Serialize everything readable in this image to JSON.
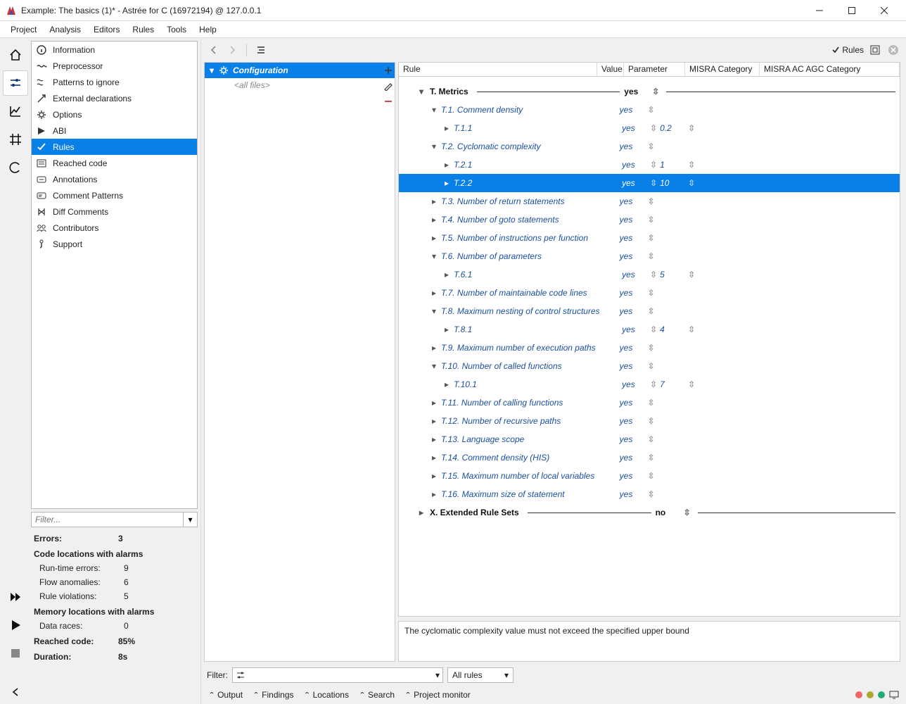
{
  "window": {
    "title": "Example: The basics (1)* - Astrée for C (16972194) @ 127.0.0.1"
  },
  "menubar": [
    "Project",
    "Analysis",
    "Editors",
    "Rules",
    "Tools",
    "Help"
  ],
  "nav": {
    "items": [
      "Information",
      "Preprocessor",
      "Patterns to ignore",
      "External declarations",
      "Options",
      "ABI",
      "Rules",
      "Reached code",
      "Annotations",
      "Comment Patterns",
      "Diff Comments",
      "Contributors",
      "Support"
    ],
    "selected": 6
  },
  "filter_placeholder": "Filter...",
  "stats": {
    "errors_label": "Errors:",
    "errors": "3",
    "cla_header": "Code locations with alarms",
    "rte_label": "Run-time errors:",
    "rte": "9",
    "flow_label": "Flow anomalies:",
    "flow": "6",
    "rulev_label": "Rule violations:",
    "rulev": "5",
    "mem_header": "Memory locations with alarms",
    "dr_label": "Data races:",
    "dr": "0",
    "reached_label": "Reached code:",
    "reached": "85%",
    "dur_label": "Duration:",
    "dur": "8s"
  },
  "config": {
    "title": "Configuration",
    "all_files": "<all files>"
  },
  "toolbar": {
    "rules_label": "Rules"
  },
  "columns": {
    "rule": "Rule",
    "value": "Value",
    "param": "Parameter",
    "misra": "MISRA Category",
    "misraac": "MISRA AC AGC Category"
  },
  "tree": [
    {
      "type": "section",
      "indent": 1,
      "twisty": "down",
      "name": "T. Metrics",
      "value": "yes"
    },
    {
      "type": "node",
      "indent": 2,
      "twisty": "down",
      "name": "T.1. Comment density",
      "value": "yes"
    },
    {
      "type": "leaf",
      "indent": 3,
      "twisty": "right",
      "name": "T.1.1",
      "value": "yes",
      "param": "0.2"
    },
    {
      "type": "node",
      "indent": 2,
      "twisty": "down",
      "name": "T.2. Cyclomatic complexity",
      "value": "yes"
    },
    {
      "type": "leaf",
      "indent": 3,
      "twisty": "right",
      "name": "T.2.1",
      "value": "yes",
      "param": "1"
    },
    {
      "type": "leaf",
      "indent": 3,
      "twisty": "right",
      "name": "T.2.2",
      "value": "yes",
      "param": "10",
      "selected": true
    },
    {
      "type": "node",
      "indent": 2,
      "twisty": "right",
      "name": "T.3. Number of return statements",
      "value": "yes"
    },
    {
      "type": "node",
      "indent": 2,
      "twisty": "right",
      "name": "T.4. Number of goto statements",
      "value": "yes"
    },
    {
      "type": "node",
      "indent": 2,
      "twisty": "right",
      "name": "T.5. Number of instructions per function",
      "value": "yes"
    },
    {
      "type": "node",
      "indent": 2,
      "twisty": "down",
      "name": "T.6. Number of parameters",
      "value": "yes"
    },
    {
      "type": "leaf",
      "indent": 3,
      "twisty": "right",
      "name": "T.6.1",
      "value": "yes",
      "param": "5"
    },
    {
      "type": "node",
      "indent": 2,
      "twisty": "right",
      "name": "T.7. Number of maintainable code lines",
      "value": "yes"
    },
    {
      "type": "node",
      "indent": 2,
      "twisty": "down",
      "name": "T.8. Maximum nesting of control structures",
      "value": "yes"
    },
    {
      "type": "leaf",
      "indent": 3,
      "twisty": "right",
      "name": "T.8.1",
      "value": "yes",
      "param": "4"
    },
    {
      "type": "node",
      "indent": 2,
      "twisty": "right",
      "name": "T.9. Maximum number of execution paths",
      "value": "yes"
    },
    {
      "type": "node",
      "indent": 2,
      "twisty": "down",
      "name": "T.10. Number of called functions",
      "value": "yes"
    },
    {
      "type": "leaf",
      "indent": 3,
      "twisty": "right",
      "name": "T.10.1",
      "value": "yes",
      "param": "7"
    },
    {
      "type": "node",
      "indent": 2,
      "twisty": "right",
      "name": "T.11. Number of calling functions",
      "value": "yes"
    },
    {
      "type": "node",
      "indent": 2,
      "twisty": "right",
      "name": "T.12. Number of recursive paths",
      "value": "yes"
    },
    {
      "type": "node",
      "indent": 2,
      "twisty": "right",
      "name": "T.13. Language scope",
      "value": "yes"
    },
    {
      "type": "node",
      "indent": 2,
      "twisty": "right",
      "name": "T.14. Comment density (HIS)",
      "value": "yes"
    },
    {
      "type": "node",
      "indent": 2,
      "twisty": "right",
      "name": "T.15. Maximum number of local variables",
      "value": "yes"
    },
    {
      "type": "node",
      "indent": 2,
      "twisty": "right",
      "name": "T.16. Maximum size of statement",
      "value": "yes"
    },
    {
      "type": "section",
      "indent": 1,
      "twisty": "right",
      "name": "X. Extended Rule Sets",
      "value": "no"
    }
  ],
  "description": "The cyclomatic complexity value must not exceed the specified upper bound",
  "filterbar": {
    "label": "Filter:",
    "allrules": "All rules"
  },
  "bottomtabs": [
    "Output",
    "Findings",
    "Locations",
    "Search",
    "Project monitor"
  ],
  "dots": [
    "#e66",
    "#aa3",
    "#2a7"
  ]
}
